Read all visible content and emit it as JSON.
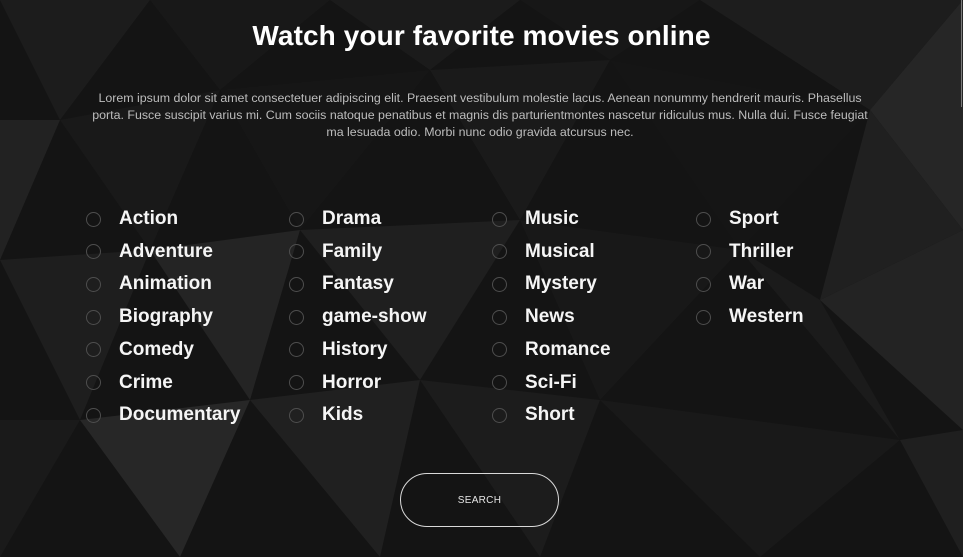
{
  "heading": "Watch your favorite movies online",
  "intro": "Lorem ipsum dolor sit amet consectetuer adipiscing elit. Praesent vestibulum molestie lacus. Aenean nonummy hendrerit mauris. Phasellus porta. Fusce suscipit varius mi. Cum sociis natoque penatibus et magnis dis parturientmontes nascetur ridiculus mus. Nulla dui. Fusce feugiat ma lesuada odio. Morbi nunc odio gravida atcursus nec.",
  "genre_columns": [
    [
      "Action",
      "Adventure",
      "Animation",
      "Biography",
      "Comedy",
      "Crime",
      "Documentary"
    ],
    [
      "Drama",
      "Family",
      "Fantasy",
      "game-show",
      "History",
      "Horror",
      "Kids"
    ],
    [
      "Music",
      "Musical",
      "Mystery",
      "News",
      "Romance",
      "Sci-Fi",
      "Short"
    ],
    [
      "Sport",
      "Thriller",
      "War",
      "Western"
    ]
  ],
  "search_button": "SEARCH",
  "colors": {
    "background": "#141414",
    "text": "#ffffff",
    "muted_text": "#bdbdbd",
    "radio_border": "#4e4e4e"
  }
}
